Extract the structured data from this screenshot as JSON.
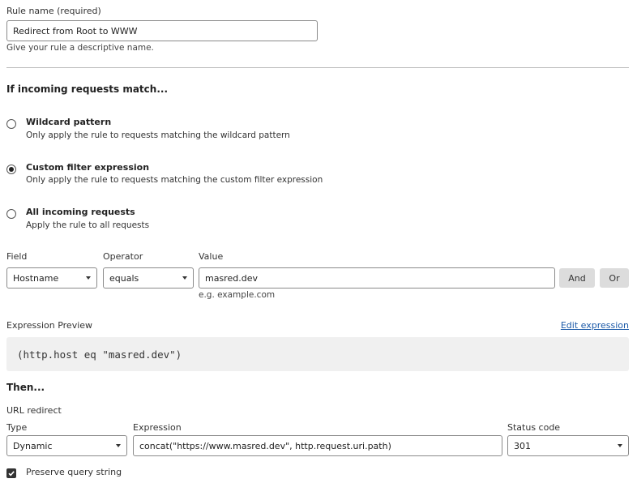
{
  "rule_name": {
    "label": "Rule name (required)",
    "value": "Redirect from Root to WWW",
    "help": "Give your rule a descriptive name."
  },
  "match": {
    "title": "If incoming requests match...",
    "options": [
      {
        "title": "Wildcard pattern",
        "desc": "Only apply the rule to requests matching the wildcard pattern",
        "selected": false
      },
      {
        "title": "Custom filter expression",
        "desc": "Only apply the rule to requests matching the custom filter expression",
        "selected": true
      },
      {
        "title": "All incoming requests",
        "desc": "Apply the rule to all requests",
        "selected": false
      }
    ]
  },
  "filter": {
    "field_label": "Field",
    "field_value": "Hostname",
    "operator_label": "Operator",
    "operator_value": "equals",
    "value_label": "Value",
    "value_value": "masred.dev",
    "value_hint": "e.g. example.com",
    "and_label": "And",
    "or_label": "Or"
  },
  "preview": {
    "label": "Expression Preview",
    "edit_link": "Edit expression",
    "code": "(http.host eq \"masred.dev\")"
  },
  "then": {
    "title": "Then...",
    "subtitle": "URL redirect",
    "type_label": "Type",
    "type_value": "Dynamic",
    "expression_label": "Expression",
    "expression_value": "concat(\"https://www.masred.dev\", http.request.uri.path)",
    "status_label": "Status code",
    "status_value": "301",
    "preserve_label": "Preserve query string",
    "preserve_checked": true
  }
}
